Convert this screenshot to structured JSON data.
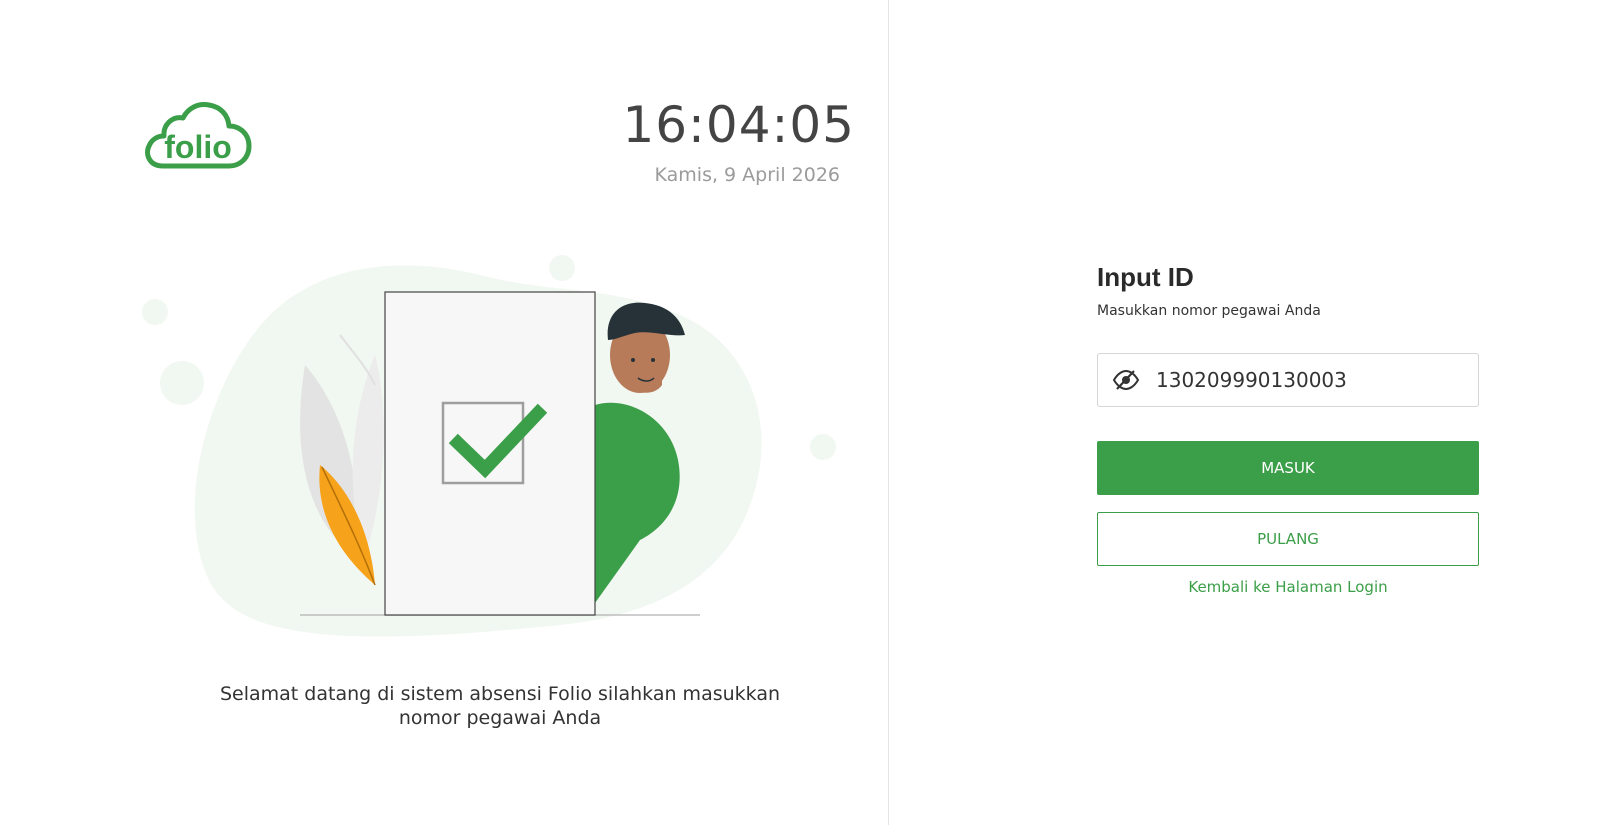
{
  "app": {
    "logo_text": "folio",
    "brand_color": "#3b9e48"
  },
  "clock": {
    "time": "16:04:05",
    "date": "Kamis, 9 April 2026"
  },
  "welcome": {
    "line1": "Selamat datang di sistem absensi Folio silahkan masukkan",
    "line2": "nomor pegawai Anda"
  },
  "form": {
    "title": "Input ID",
    "subtitle": "Masukkan nomor pegawai Anda",
    "id_value": "130209990130003",
    "toggle_icon": "eye-slash-icon",
    "masuk_label": "MASUK",
    "pulang_label": "PULANG",
    "back_link": "Kembali ke Halaman Login"
  }
}
